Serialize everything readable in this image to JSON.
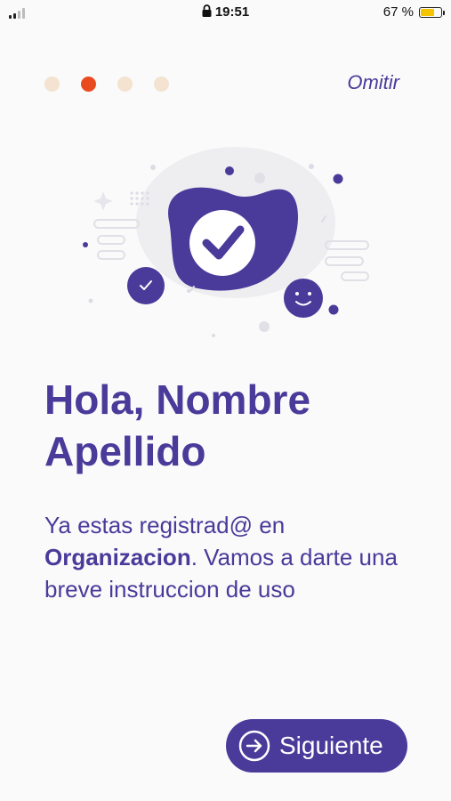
{
  "status_bar": {
    "time": "19:51",
    "battery_percent": "67 %",
    "battery_level": 0.67,
    "icons": [
      "signal-icon",
      "lock-icon",
      "battery-icon"
    ]
  },
  "pager": {
    "total": 4,
    "active_index": 1
  },
  "header": {
    "skip_label": "Omitir"
  },
  "illustration": {
    "icons": [
      "check-badge-icon",
      "small-check-icon",
      "smiley-icon"
    ]
  },
  "main": {
    "title": "Hola, Nombre Apellido",
    "body_prefix": "Ya estas registrad@ en ",
    "organization": "Organizacion",
    "body_suffix": ". Vamos a darte una breve instruccion de uso"
  },
  "footer": {
    "next_label": "Siguiente"
  },
  "colors": {
    "primary": "#4a3a9a",
    "accent": "#ea4b1e",
    "dot_inactive": "#f3e3d0"
  }
}
